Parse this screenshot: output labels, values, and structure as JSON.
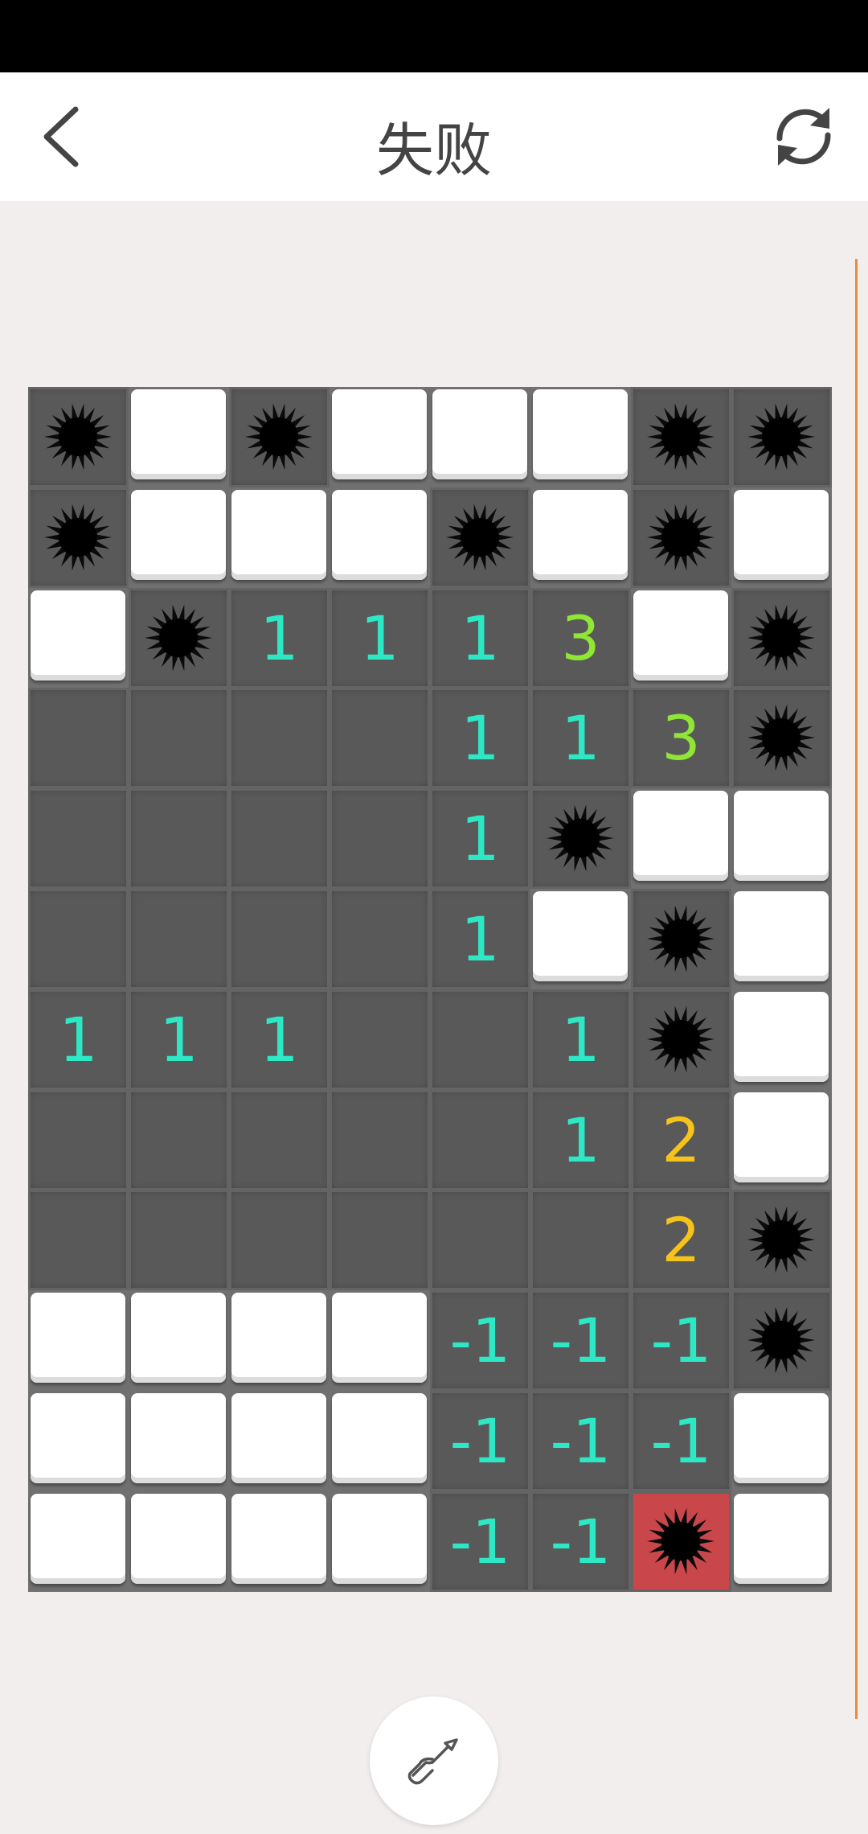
{
  "header": {
    "title": "失败",
    "back_icon": "chevron-left-icon",
    "refresh_icon": "refresh-icon"
  },
  "colors": {
    "1": "#2de8c4",
    "2": "#f5c31c",
    "3": "#8fe634",
    "-1": "#2de8c4",
    "exploded": "#c9474a",
    "covered": "#ffffff",
    "revealed": "#595959",
    "accent_line": "#ee8a3c"
  },
  "board": {
    "rows": 12,
    "cols": 8,
    "legend": {
      "C": "covered",
      "E": "revealed-empty",
      "M": "mine",
      "X": "exploded-mine"
    },
    "cells": [
      [
        "M",
        "C",
        "M",
        "C",
        "C",
        "C",
        "M",
        "M"
      ],
      [
        "M",
        "C",
        "C",
        "C",
        "M",
        "C",
        "M",
        "C"
      ],
      [
        "C",
        "M",
        "1",
        "1",
        "1",
        "3",
        "C",
        "M"
      ],
      [
        "E",
        "E",
        "E",
        "E",
        "1",
        "1",
        "3",
        "M"
      ],
      [
        "E",
        "E",
        "E",
        "E",
        "1",
        "M",
        "C",
        "C"
      ],
      [
        "E",
        "E",
        "E",
        "E",
        "1",
        "C",
        "M",
        "C"
      ],
      [
        "1",
        "1",
        "1",
        "E",
        "E",
        "1",
        "M",
        "C"
      ],
      [
        "E",
        "E",
        "E",
        "E",
        "E",
        "1",
        "2",
        "C"
      ],
      [
        "E",
        "E",
        "E",
        "E",
        "E",
        "E",
        "2",
        "M"
      ],
      [
        "C",
        "C",
        "C",
        "C",
        "-1",
        "-1",
        "-1",
        "M"
      ],
      [
        "C",
        "C",
        "C",
        "C",
        "-1",
        "-1",
        "-1",
        "C"
      ],
      [
        "C",
        "C",
        "C",
        "C",
        "-1",
        "-1",
        "X",
        "C"
      ]
    ]
  },
  "tool": {
    "icon": "shovel-icon",
    "mode": "dig"
  }
}
